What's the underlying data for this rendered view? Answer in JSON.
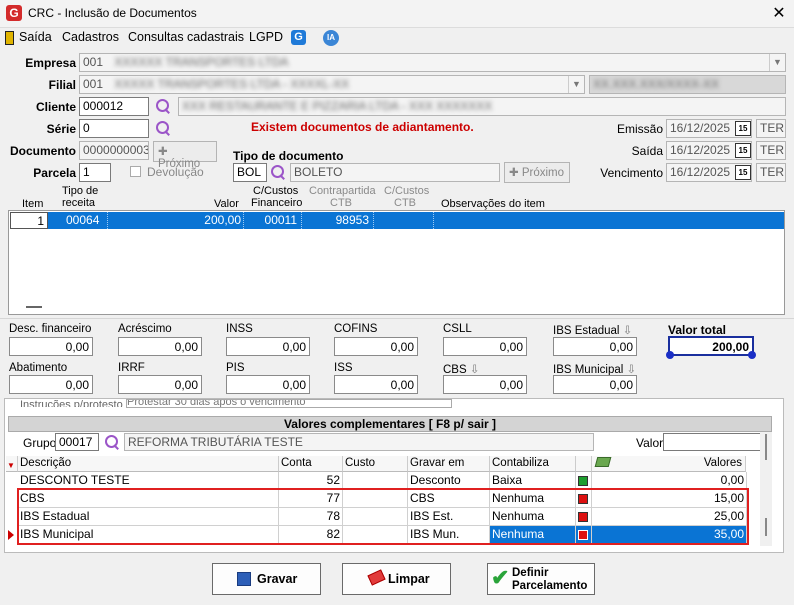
{
  "window": {
    "title": "CRC - Inclusão de Documentos",
    "close": "✕",
    "icon_letter": "G"
  },
  "menu": {
    "saida": "Saída",
    "cadastros": "Cadastros",
    "consultas": "Consultas cadastrais",
    "lgpd": "LGPD",
    "ia_badge": "IA"
  },
  "form": {
    "empresa_label": "Empresa",
    "empresa_code": "001",
    "empresa_name": "XXXXXX TRANSPORTES LTDA",
    "filial_label": "Filial",
    "filial_code": "001",
    "filial_name": "XXXXX TRANSPORTES LTDA - XXXXL-XX",
    "filial_extra": "XX.XXX.XXX/XXXX-XX",
    "cliente_label": "Cliente",
    "cliente_code": "000012",
    "cliente_name": "XXX RESTAURANTE E PIZZARIA LTDA - XXX XXXXXXX",
    "serie_label": "Série",
    "serie_value": "0",
    "warning": "Existem documentos de adiantamento.",
    "documento_label": "Documento",
    "documento_value": "0000000003",
    "proximo_label": "Próximo",
    "tipo_doc_label": "Tipo de documento",
    "tipo_doc_code": "BOL",
    "tipo_doc_name": "BOLETO",
    "parcela_label": "Parcela",
    "parcela_value": "1",
    "devolucao_label": "Devolução",
    "emissao_label": "Emissão",
    "emissao_value": "16/12/2025",
    "emissao_day": "TER",
    "saida_label": "Saída",
    "saida_value": "16/12/2025",
    "saida_day": "TER",
    "vencimento_label": "Vencimento",
    "vencimento_value": "16/12/2025",
    "vencimento_day": "TER",
    "cal_icon": "15"
  },
  "items_grid": {
    "headers": {
      "item": "Item",
      "tipo_receita_1": "Tipo de",
      "tipo_receita_2": "receita",
      "valor": "Valor",
      "ccustos_fin_1": "C/Custos",
      "ccustos_fin_2": "Financeiro",
      "contrapartida_1": "Contrapartida",
      "contrapartida_2": "CTB",
      "ccustos_ctb_1": "C/Custos",
      "ccustos_ctb_2": "CTB",
      "obs": "Observações do item"
    },
    "row": {
      "item": "1",
      "tipo_receita": "00064",
      "valor": "200,00",
      "ccustos_fin": "00011",
      "contrapartida": "98953"
    }
  },
  "totals": {
    "desc_fin_label": "Desc. financeiro",
    "desc_fin": "0,00",
    "acrescimo_label": "Acréscimo",
    "acrescimo": "0,00",
    "inss_label": "INSS",
    "inss": "0,00",
    "cofins_label": "COFINS",
    "cofins": "0,00",
    "csll_label": "CSLL",
    "csll": "0,00",
    "ibs_estadual_label": "IBS Estadual",
    "ibs_estadual": "0,00",
    "valor_total_label": "Valor total",
    "valor_total": "200,00",
    "abatimento_label": "Abatimento",
    "abatimento": "0,00",
    "irrf_label": "IRRF",
    "irrf": "0,00",
    "pis_label": "PIS",
    "pis": "0,00",
    "iss_label": "ISS",
    "iss": "0,00",
    "cbs_label": "CBS",
    "cbs": "0,00",
    "ibs_municipal_label": "IBS Municipal",
    "ibs_municipal": "0,00"
  },
  "complementary": {
    "instrucoes_label": "Instruções p/protesto",
    "instrucoes_value": "Protestar 30 dias após o vencimento",
    "title": "Valores complementares [ F8 p/ sair ]",
    "grupo_label": "Grupo",
    "grupo_code": "00017",
    "grupo_name": "REFORMA TRIBUTÁRIA TESTE",
    "valor_label": "Valor",
    "headers": {
      "descricao": "Descrição",
      "conta": "Conta",
      "custo": "Custo",
      "gravar_em": "Gravar em",
      "contabiliza": "Contabiliza",
      "valores": "Valores"
    },
    "rows": [
      {
        "descricao": "DESCONTO TESTE",
        "conta": "52",
        "custo": "",
        "gravar_em": "Desconto",
        "contabiliza": "Baixa",
        "status": "green",
        "valor": "0,00"
      },
      {
        "descricao": "CBS",
        "conta": "77",
        "custo": "",
        "gravar_em": "CBS",
        "contabiliza": "Nenhuma",
        "status": "red",
        "valor": "15,00"
      },
      {
        "descricao": "IBS Estadual",
        "conta": "78",
        "custo": "",
        "gravar_em": "IBS Est.",
        "contabiliza": "Nenhuma",
        "status": "red",
        "valor": "25,00"
      },
      {
        "descricao": "IBS Municipal",
        "conta": "82",
        "custo": "",
        "gravar_em": "IBS Mun.",
        "contabiliza": "Nenhuma",
        "status": "red",
        "valor": "35,00"
      }
    ]
  },
  "buttons": {
    "gravar": "Gravar",
    "limpar": "Limpar",
    "definir_1": "Definir",
    "definir_2": "Parcelamento"
  },
  "colors": {
    "selection": "#0a74d4",
    "highlight_border": "#e02020",
    "warning_text": "#cc0000",
    "accent_purple": "#9b55c8"
  }
}
